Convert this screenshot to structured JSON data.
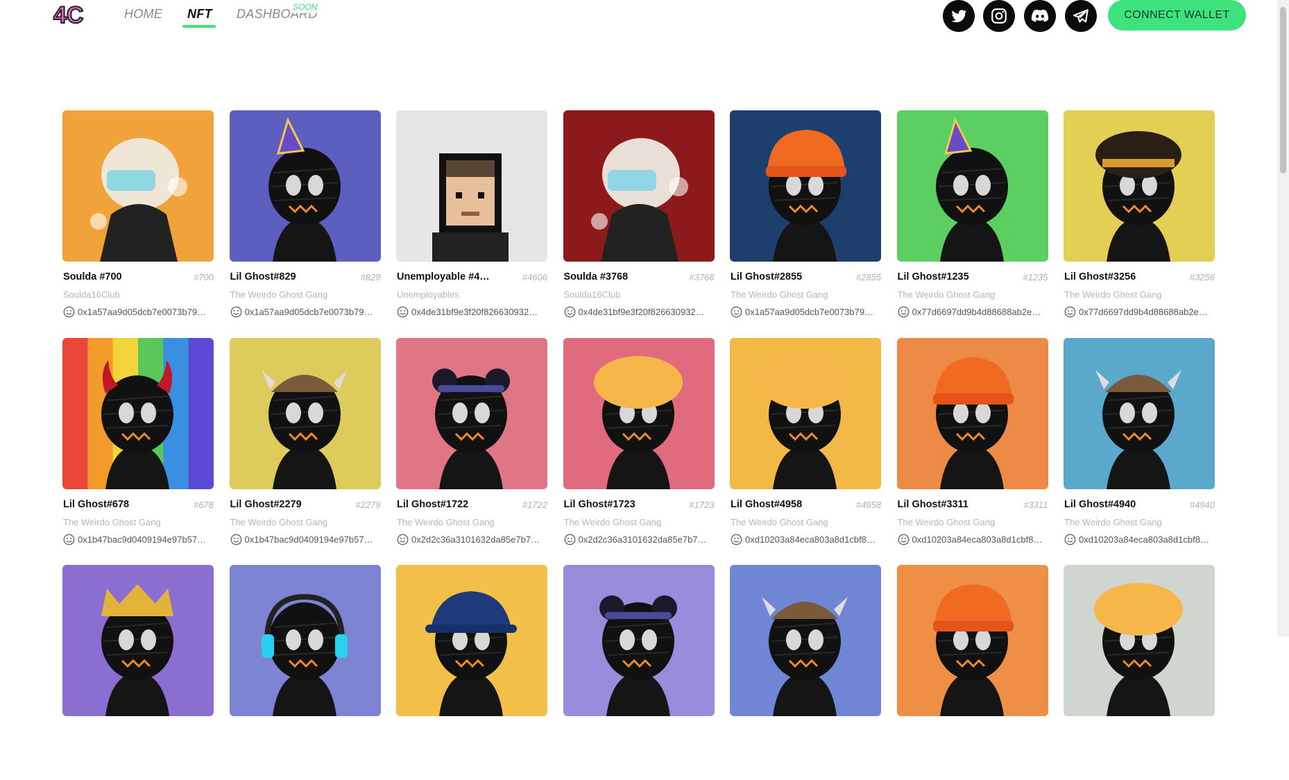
{
  "header": {
    "logo_text": "4C",
    "nav": [
      {
        "label": "HOME",
        "active": false
      },
      {
        "label": "NFT",
        "active": true
      },
      {
        "label": "DASHBOARD",
        "active": false
      }
    ],
    "soon_badge": "SOON",
    "socials": [
      "twitter-icon",
      "instagram-icon",
      "discord-icon",
      "telegram-icon"
    ],
    "connect_label": "CONNECT WALLET",
    "accent_color": "#3ee37d"
  },
  "nfts": [
    {
      "name": "Soulda #700",
      "num": "#700",
      "collection": "Soulda16Club",
      "owner": "0x1a57aa9d05dcb7e0073b79…",
      "bg": "#f0a33b",
      "art": "soulda-avatar"
    },
    {
      "name": "Lil Ghost#829",
      "num": "#829",
      "collection": "The Weirdo Ghost Gang",
      "owner": "0x1a57aa9d05dcb7e0073b79…",
      "bg": "#5d5fc0",
      "art": "ghost-party-hat"
    },
    {
      "name": "Unemployable #4…",
      "num": "#4606",
      "collection": "Unemployables",
      "owner": "0x4de31bf9e3f20f826630932…",
      "bg": "#e6e6e6",
      "art": "pixel-man"
    },
    {
      "name": "Soulda #3768",
      "num": "#3768",
      "collection": "Soulda16Club",
      "owner": "0x4de31bf9e3f20f826630932…",
      "bg": "#8c1a1a",
      "art": "soulda-avatar"
    },
    {
      "name": "Lil Ghost#2855",
      "num": "#2855",
      "collection": "The Weirdo Ghost Gang",
      "owner": "0x1a57aa9d05dcb7e0073b79…",
      "bg": "#1d3f6e",
      "art": "ghost-beanie"
    },
    {
      "name": "Lil Ghost#1235",
      "num": "#1235",
      "collection": "The Weirdo Ghost Gang",
      "owner": "0x77d6697dd9b4d88688ab2e…",
      "bg": "#5ccf62",
      "art": "ghost-party-hat"
    },
    {
      "name": "Lil Ghost#3256",
      "num": "#3256",
      "collection": "The Weirdo Ghost Gang",
      "owner": "0x77d6697dd9b4d88688ab2e…",
      "bg": "#e4cf55",
      "art": "ghost-dreads"
    },
    {
      "name": "Lil Ghost#678",
      "num": "#678",
      "collection": "The Weirdo Ghost Gang",
      "owner": "0x1b47bac9d0409194e97b57…",
      "bg": "rainbow",
      "art": "ghost-devil"
    },
    {
      "name": "Lil Ghost#2279",
      "num": "#2279",
      "collection": "The Weirdo Ghost Gang",
      "owner": "0x1b47bac9d0409194e97b57…",
      "bg": "#ddcc5c",
      "art": "ghost-viking"
    },
    {
      "name": "Lil Ghost#1722",
      "num": "#1722",
      "collection": "The Weirdo Ghost Gang",
      "owner": "0x2d2c36a3101632da85e7b7…",
      "bg": "#e07585",
      "art": "ghost-buns"
    },
    {
      "name": "Lil Ghost#1723",
      "num": "#1723",
      "collection": "The Weirdo Ghost Gang",
      "owner": "0x2d2c36a3101632da85e7b7…",
      "bg": "#e06a7e",
      "art": "ghost-curly"
    },
    {
      "name": "Lil Ghost#4958",
      "num": "#4958",
      "collection": "The Weirdo Ghost Gang",
      "owner": "0xd10203a84eca803a8d1cbf8…",
      "bg": "#f2b947",
      "art": "ghost-curly"
    },
    {
      "name": "Lil Ghost#3311",
      "num": "#3311",
      "collection": "The Weirdo Ghost Gang",
      "owner": "0xd10203a84eca803a8d1cbf8…",
      "bg": "#ec8a46",
      "art": "ghost-beanie"
    },
    {
      "name": "Lil Ghost#4940",
      "num": "#4940",
      "collection": "The Weirdo Ghost Gang",
      "owner": "0xd10203a84eca803a8d1cbf8…",
      "bg": "#5aa9cc",
      "art": "ghost-viking"
    },
    {
      "name": "",
      "num": "",
      "collection": "",
      "owner": "",
      "bg": "#8b6fd0",
      "art": "ghost-crown"
    },
    {
      "name": "",
      "num": "",
      "collection": "",
      "owner": "",
      "bg": "#7e84d4",
      "art": "ghost-headphones"
    },
    {
      "name": "",
      "num": "",
      "collection": "",
      "owner": "",
      "bg": "#f2c049",
      "art": "ghost-bucket-hat"
    },
    {
      "name": "",
      "num": "",
      "collection": "",
      "owner": "",
      "bg": "#9a8cdc",
      "art": "ghost-buns"
    },
    {
      "name": "",
      "num": "",
      "collection": "",
      "owner": "",
      "bg": "#6f86d4",
      "art": "ghost-viking"
    },
    {
      "name": "",
      "num": "",
      "collection": "",
      "owner": "",
      "bg": "#ee8f45",
      "art": "ghost-beanie"
    },
    {
      "name": "",
      "num": "",
      "collection": "",
      "owner": "",
      "bg": "#cfd6cf",
      "art": "ghost-curly"
    }
  ]
}
